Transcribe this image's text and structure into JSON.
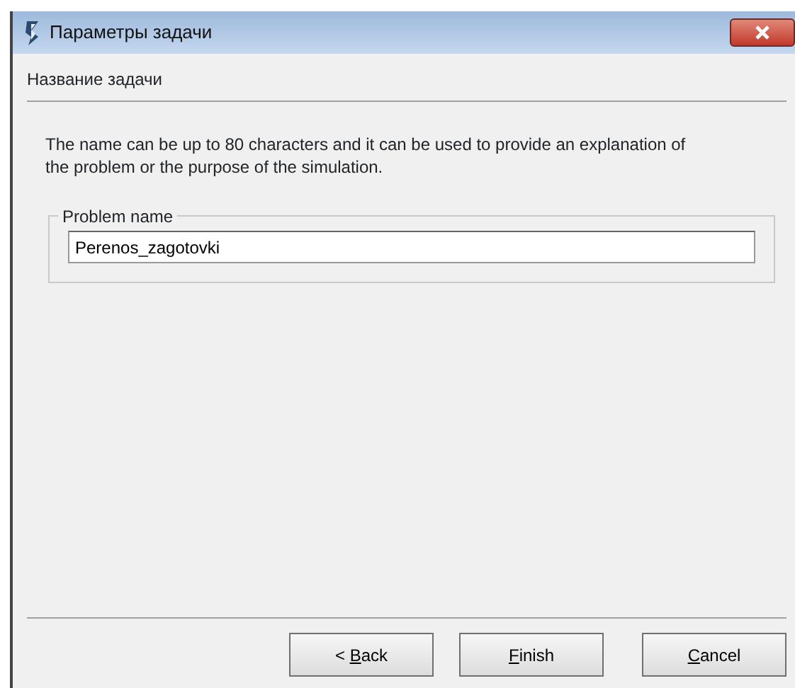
{
  "window": {
    "title": "Параметры задачи"
  },
  "page_header": "Название задачи",
  "description": "The name can be up to 80 characters and it can be used to provide an explanation of the problem or the purpose of the simulation.",
  "problem_name_group": {
    "legend": "Problem name",
    "value": "Perenos_zagotovki"
  },
  "buttons": [
    {
      "before": "< ",
      "access_key": "B",
      "after": "ack"
    },
    {
      "access_key": "F",
      "after": "inish"
    },
    {
      "access_key": "C",
      "after": "ancel"
    }
  ]
}
